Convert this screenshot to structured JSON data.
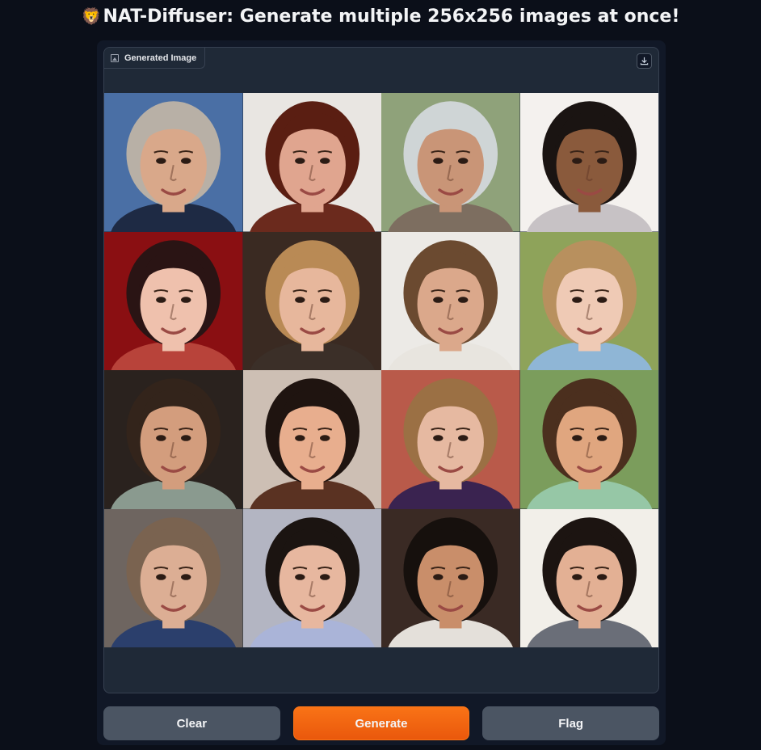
{
  "header": {
    "logo_icon": "🦁",
    "title": "NAT-Diffuser: Generate multiple 256x256 images at once!"
  },
  "output": {
    "label": "Generated Image",
    "label_icon": "image-icon",
    "download_icon": "download-icon",
    "faces": [
      {
        "bg": "#4a6fa5",
        "skin": "#d9a88a",
        "hair": "#b8b0a6",
        "cloth": "#1e2a44"
      },
      {
        "bg": "#e9e6e2",
        "skin": "#e0a58f",
        "hair": "#5a1e12",
        "cloth": "#6b2a1d"
      },
      {
        "bg": "#8fa27a",
        "skin": "#c99577",
        "hair": "#cfd5d6",
        "cloth": "#7d6e60"
      },
      {
        "bg": "#f4f1ee",
        "skin": "#8a5a3c",
        "hair": "#1a1412",
        "cloth": "#c7c2c5"
      },
      {
        "bg": "#8a0f12",
        "skin": "#efc1ad",
        "hair": "#2a1414",
        "cloth": "#b8433a"
      },
      {
        "bg": "#3a2a22",
        "skin": "#e7b79c",
        "hair": "#b98a55",
        "cloth": "#3b2f28"
      },
      {
        "bg": "#eceae6",
        "skin": "#dba88b",
        "hair": "#6b4a30",
        "cloth": "#e8e5df"
      },
      {
        "bg": "#8ea35a",
        "skin": "#efcab5",
        "hair": "#b8905e",
        "cloth": "#8fb6d6"
      },
      {
        "bg": "#2a221e",
        "skin": "#d39d7d",
        "hair": "#33241b",
        "cloth": "#8a9a8f"
      },
      {
        "bg": "#cdbfb4",
        "skin": "#e8ae8e",
        "hair": "#1f1410",
        "cloth": "#5a3222"
      },
      {
        "bg": "#b95a4a",
        "skin": "#e6b9a1",
        "hair": "#9b7044",
        "cloth": "#3a2350"
      },
      {
        "bg": "#7b9d5c",
        "skin": "#e0a67f",
        "hair": "#4b2f1e",
        "cloth": "#96c7a6"
      },
      {
        "bg": "#6e6560",
        "skin": "#dcae94",
        "hair": "#7a6350",
        "cloth": "#2b3f6c"
      },
      {
        "bg": "#b3b5c2",
        "skin": "#e7b79f",
        "hair": "#1b1411",
        "cloth": "#aab4d8"
      },
      {
        "bg": "#3a2a24",
        "skin": "#c98e6a",
        "hair": "#16100d",
        "cloth": "#e4e0da"
      },
      {
        "bg": "#f2efe9",
        "skin": "#e3b094",
        "hair": "#1c1411",
        "cloth": "#6a6e78"
      }
    ]
  },
  "actions": {
    "clear_label": "Clear",
    "generate_label": "Generate",
    "flag_label": "Flag"
  },
  "colors": {
    "page_bg": "#0b0f19",
    "panel_bg": "#111827",
    "primary": "#f97316",
    "secondary_button": "#4b5563"
  }
}
